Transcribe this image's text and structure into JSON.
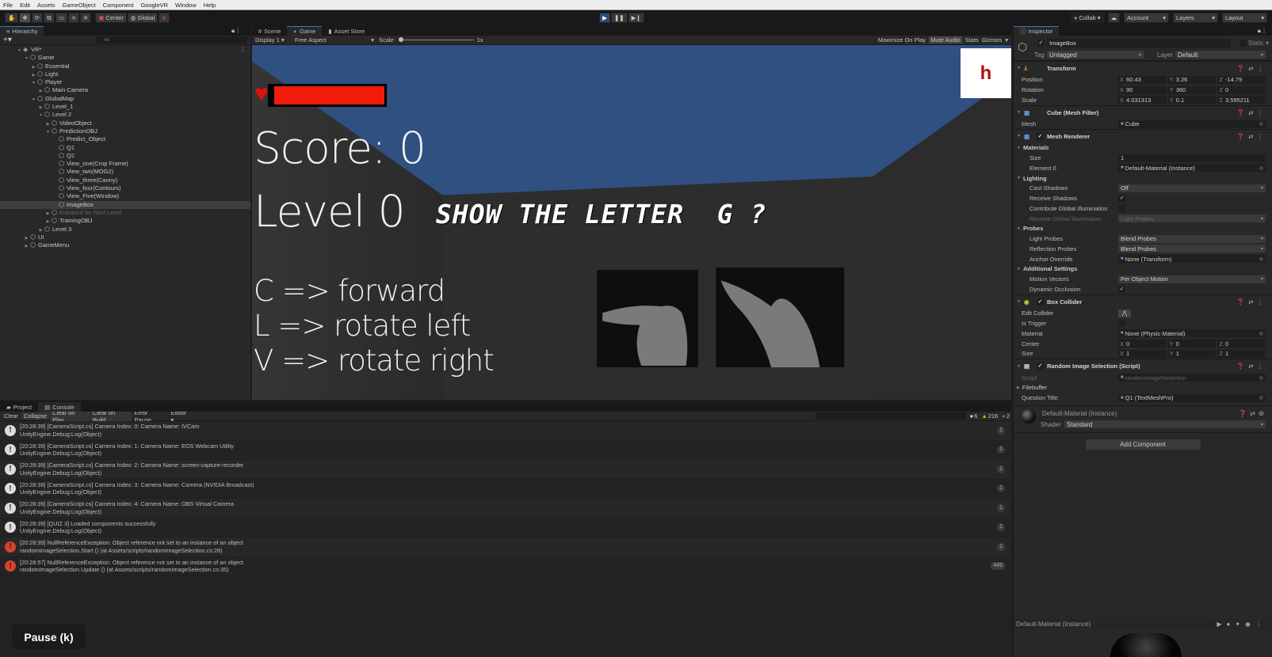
{
  "menu": [
    "File",
    "Edit",
    "Assets",
    "GameObject",
    "Component",
    "GoogleVR",
    "Window",
    "Help"
  ],
  "toolbar": {
    "center": "Center",
    "global": "Global",
    "collab": "Collab",
    "account": "Account",
    "layers": "Layers",
    "layout": "Layout"
  },
  "hierarchy": {
    "tab": "Hierarchy",
    "search_placeholder": "All",
    "items": [
      {
        "label": "VR*",
        "depth": 0,
        "state": "open",
        "kind": "scene"
      },
      {
        "label": "Game",
        "depth": 1,
        "state": "open"
      },
      {
        "label": "Essential",
        "depth": 2,
        "state": "closed"
      },
      {
        "label": "Light",
        "depth": 2,
        "state": "closed"
      },
      {
        "label": "Player",
        "depth": 2,
        "state": "open"
      },
      {
        "label": "Main Camera",
        "depth": 3,
        "state": "closed"
      },
      {
        "label": "GlobalMap",
        "depth": 2,
        "state": "open"
      },
      {
        "label": "Level_1",
        "depth": 3,
        "state": "closed"
      },
      {
        "label": "Level 2",
        "depth": 3,
        "state": "open"
      },
      {
        "label": "VideoObject",
        "depth": 4,
        "state": "closed"
      },
      {
        "label": "PredictionOBJ",
        "depth": 4,
        "state": "open"
      },
      {
        "label": "Predict_Object",
        "depth": 5,
        "state": "none"
      },
      {
        "label": "Q1",
        "depth": 5,
        "state": "none"
      },
      {
        "label": "Q2",
        "depth": 5,
        "state": "none"
      },
      {
        "label": "View_one(Crop Frame)",
        "depth": 5,
        "state": "none"
      },
      {
        "label": "View_two(MOG2)",
        "depth": 5,
        "state": "none"
      },
      {
        "label": "View_three(Canny)",
        "depth": 5,
        "state": "none"
      },
      {
        "label": "View_four(Contours)",
        "depth": 5,
        "state": "none"
      },
      {
        "label": "View_Five(Window)",
        "depth": 5,
        "state": "none"
      },
      {
        "label": "ImageBox",
        "depth": 5,
        "state": "none",
        "selected": true
      },
      {
        "label": "Entrance for Next Level",
        "depth": 4,
        "state": "closed",
        "disabled": true
      },
      {
        "label": "TrainingOBJ",
        "depth": 4,
        "state": "closed"
      },
      {
        "label": "Level 3",
        "depth": 3,
        "state": "closed"
      },
      {
        "label": "UI",
        "depth": 1,
        "state": "closed"
      },
      {
        "label": "GameMenu",
        "depth": 1,
        "state": "closed"
      }
    ]
  },
  "game": {
    "tabs": [
      "Scene",
      "Game",
      "Asset Store"
    ],
    "display": "Display 1",
    "aspect": "Free Aspect",
    "scale_label": "Scale",
    "scale_value": "1x",
    "maximize": "Maximize On Play",
    "mute": "Mute Audio",
    "stats": "Stats",
    "gizmos": "Gizmos",
    "health": 1.0,
    "score": "Score: 0",
    "level": "Level 0",
    "question": "SHOW THE LETTER  G ?",
    "corner_letter": "h",
    "controls": [
      "C => forward",
      "L => rotate left",
      "V => rotate right"
    ]
  },
  "console": {
    "tabs": [
      "Project",
      "Console"
    ],
    "buttons": [
      "Clear",
      "Collapse",
      "Clear on Play",
      "Clear on Build",
      "Error Pause",
      "Editor"
    ],
    "counts": {
      "log": "6",
      "warn": "216",
      "error": "2"
    },
    "entries": [
      {
        "type": "log",
        "line1": "[20:28:39] [CameraScript.cs] Camera Index: 0: Camera Name: IVCam",
        "line2": "UnityEngine.Debug:Log(Object)",
        "count": "1"
      },
      {
        "type": "log",
        "line1": "[20:28:39] [CameraScript.cs] Camera Index: 1: Camera Name: EOS Webcam Utility",
        "line2": "UnityEngine.Debug:Log(Object)",
        "count": "1"
      },
      {
        "type": "log",
        "line1": "[20:28:39] [CameraScript.cs] Camera Index: 2: Camera Name: screen-capture-recorder",
        "line2": "UnityEngine.Debug:Log(Object)",
        "count": "1"
      },
      {
        "type": "log",
        "line1": "[20:28:39] [CameraScript.cs] Camera Index: 3: Camera Name: Camera (NVIDIA Broadcast)",
        "line2": "UnityEngine.Debug:Log(Object)",
        "count": "1"
      },
      {
        "type": "log",
        "line1": "[20:28:39] [CameraScript.cs] Camera Index: 4: Camera Name: OBS Virtual Camera",
        "line2": "UnityEngine.Debug:Log(Object)",
        "count": "1"
      },
      {
        "type": "log",
        "line1": "[20:28:39] [QUIZ 3] Loaded components successfully",
        "line2": "UnityEngine.Debug:Log(Object)",
        "count": "1"
      },
      {
        "type": "error",
        "line1": "[20:28:39] NullReferenceException: Object reference not set to an instance of an object",
        "line2": "randomImageSelection.Start () (at Assets/scripts/randomImageSelection.cs:28)",
        "count": "1"
      },
      {
        "type": "error",
        "line1": "[20:28:57] NullReferenceException: Object reference not set to an instance of an object",
        "line2": "randomImageSelection.Update () (at Assets/scripts/randomImageSelection.cs:35)",
        "count": "445"
      }
    ]
  },
  "inspector": {
    "tab": "Inspector",
    "name": "ImageBox",
    "static": "Static",
    "tag_label": "Tag",
    "tag": "Untagged",
    "layer_label": "Layer",
    "layer": "Default",
    "rows": [
      {
        "t": "comp",
        "label": "Transform",
        "icon": "transform"
      },
      {
        "t": "vec",
        "label": "Position",
        "x": "60.43",
        "y": "3.26",
        "z": "-14.79"
      },
      {
        "t": "vec",
        "label": "Rotation",
        "x": "90",
        "y": "360",
        "z": "0"
      },
      {
        "t": "vec",
        "label": "Scale",
        "x": "4.031313",
        "y": "0.1",
        "z": "3.595211"
      },
      {
        "t": "comp",
        "label": "Cube (Mesh Filter)",
        "icon": "mesh-filter"
      },
      {
        "t": "obj",
        "label": "Mesh",
        "value": "Cube"
      },
      {
        "t": "comp",
        "label": "Mesh Renderer",
        "icon": "mesh-renderer",
        "check": true
      },
      {
        "t": "grp",
        "label": "Materials"
      },
      {
        "t": "text",
        "label": "Size",
        "value": "1",
        "l2": true
      },
      {
        "t": "obj",
        "label": "Element 0",
        "value": "Default-Material (Instance)",
        "l2": true
      },
      {
        "t": "grp",
        "label": "Lighting"
      },
      {
        "t": "dd",
        "label": "Cast Shadows",
        "value": "Off",
        "l2": true
      },
      {
        "t": "chk",
        "label": "Receive Shadows",
        "on": true,
        "l2": true
      },
      {
        "t": "chk",
        "label": "Contribute Global Illumination",
        "on": false,
        "l2": true
      },
      {
        "t": "dd",
        "label": "Receive Global Illumination",
        "value": "Light Probes",
        "l2": true,
        "dim": true
      },
      {
        "t": "grp",
        "label": "Probes"
      },
      {
        "t": "dd",
        "label": "Light Probes",
        "value": "Blend Probes",
        "l2": true
      },
      {
        "t": "dd",
        "label": "Reflection Probes",
        "value": "Blend Probes",
        "l2": true
      },
      {
        "t": "obj",
        "label": "Anchor Override",
        "value": "None (Transform)",
        "l2": true
      },
      {
        "t": "grp",
        "label": "Additional Settings"
      },
      {
        "t": "dd",
        "label": "Motion Vectors",
        "value": "Per Object Motion",
        "l2": true
      },
      {
        "t": "chk",
        "label": "Dynamic Occlusion",
        "on": true,
        "l2": true
      },
      {
        "t": "comp",
        "label": "Box Collider",
        "icon": "box-collider",
        "check": true
      },
      {
        "t": "btn",
        "label": "Edit Collider"
      },
      {
        "t": "chk",
        "label": "Is Trigger",
        "on": false
      },
      {
        "t": "obj",
        "label": "Material",
        "value": "None (Physic Material)"
      },
      {
        "t": "vec",
        "label": "Center",
        "x": "0",
        "y": "0",
        "z": "0"
      },
      {
        "t": "vec",
        "label": "Size",
        "x": "1",
        "y": "1",
        "z": "1"
      },
      {
        "t": "comp",
        "label": "Random Image Selection (Script)",
        "icon": "script",
        "check": true
      },
      {
        "t": "obj",
        "label": "Script",
        "value": "randomImageSelection",
        "dim": true
      },
      {
        "t": "grp",
        "label": "Filebuffer",
        "light": true
      },
      {
        "t": "obj",
        "label": "Question Title",
        "value": "Q1 (TextMeshPro)"
      }
    ],
    "material_name": "Default-Material (Instance)",
    "shader_label": "Shader",
    "shader": "Standard",
    "add_component": "Add Component",
    "preview_title": "Default-Material (Instance)"
  },
  "tooltip": "Pause (k)"
}
